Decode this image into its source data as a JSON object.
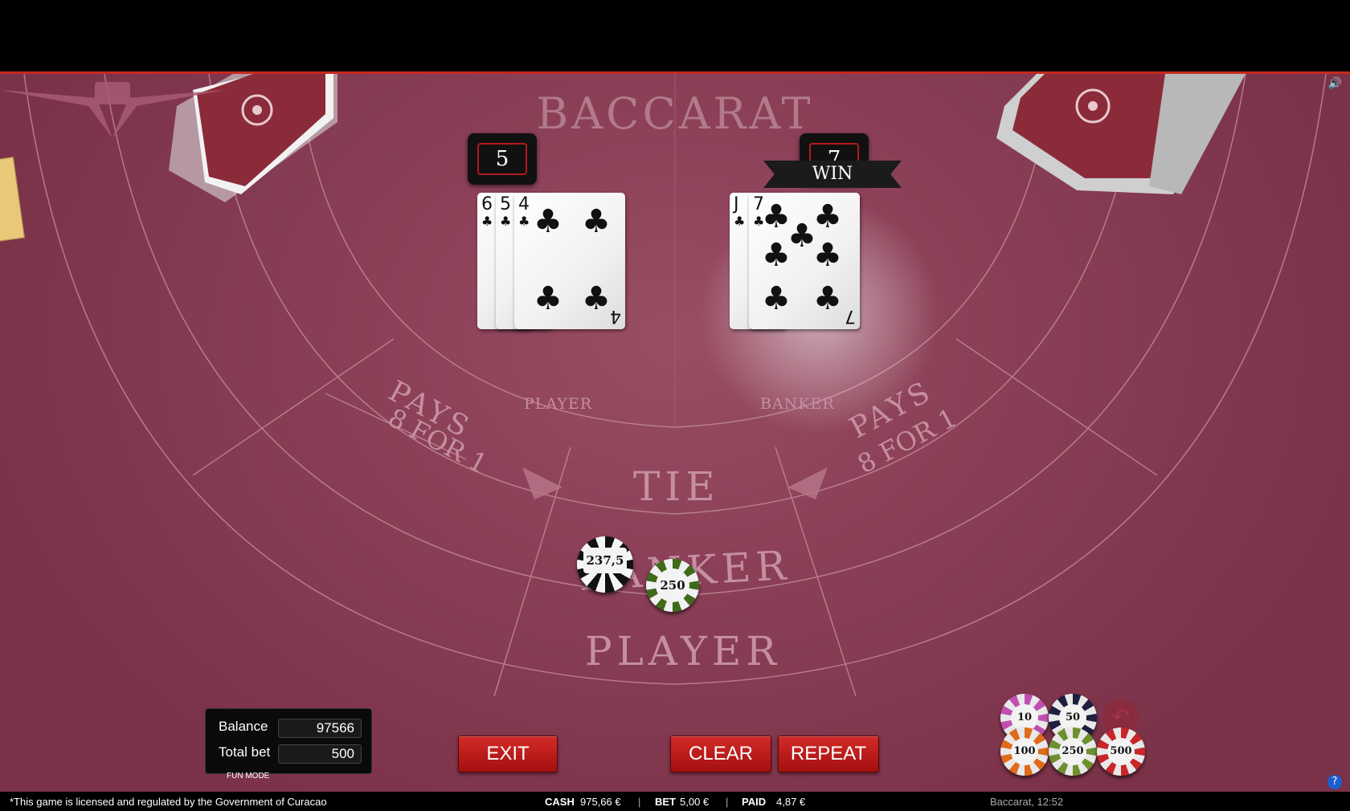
{
  "table": {
    "title": "BACCARAT",
    "player_area_label": "PLAYER",
    "banker_area_label": "BANKER",
    "pays_left": [
      "PAYS",
      "8 FOR 1"
    ],
    "pays_right": [
      "PAYS",
      "8 FOR 1"
    ],
    "tie_label": "TIE",
    "banker_bet_label": "BANKER",
    "player_bet_label": "PLAYER"
  },
  "player_hand": {
    "score": "5",
    "cards": [
      {
        "rank": "6",
        "suit": "♣"
      },
      {
        "rank": "5",
        "suit": "♣"
      },
      {
        "rank": "4",
        "suit": "♣"
      }
    ]
  },
  "banker_hand": {
    "score": "7",
    "result": "WIN",
    "cards": [
      {
        "rank": "J",
        "suit": "♣"
      },
      {
        "rank": "7",
        "suit": "♣"
      }
    ]
  },
  "bets": {
    "payout_chip": "237,5",
    "banker_chip": "250"
  },
  "info": {
    "balance_label": "Balance",
    "balance_value": "97566",
    "total_bet_label": "Total bet",
    "total_bet_value": "500",
    "mode": "FUN MODE"
  },
  "buttons": {
    "exit": "EXIT",
    "clear": "CLEAR",
    "repeat": "REPEAT"
  },
  "chip_selector": [
    {
      "value": "10",
      "color": "#c04fb0"
    },
    {
      "value": "50",
      "color": "#1e1e3e"
    },
    {
      "value": "100",
      "color": "#e06b1a"
    },
    {
      "value": "250",
      "color": "#6d8f2e"
    },
    {
      "value": "500",
      "color": "#c8262a"
    }
  ],
  "footer": {
    "license": "*This game is licensed and regulated by the Government of Curacao",
    "cash_label": "CASH",
    "cash_value": "975,66 €",
    "bet_label": "BET",
    "bet_value": "5,00 €",
    "paid_label": "PAID",
    "paid_value": "4,87 €",
    "separator": "|",
    "game_time": "Baccarat, 12:52"
  },
  "icons": {
    "sound": "speaker-icon",
    "help": "help-icon",
    "undo": "undo-icon"
  },
  "colors": {
    "felt": "#8a3f56",
    "button_red": "#c11d1c",
    "accent_line": "#c8281c"
  }
}
